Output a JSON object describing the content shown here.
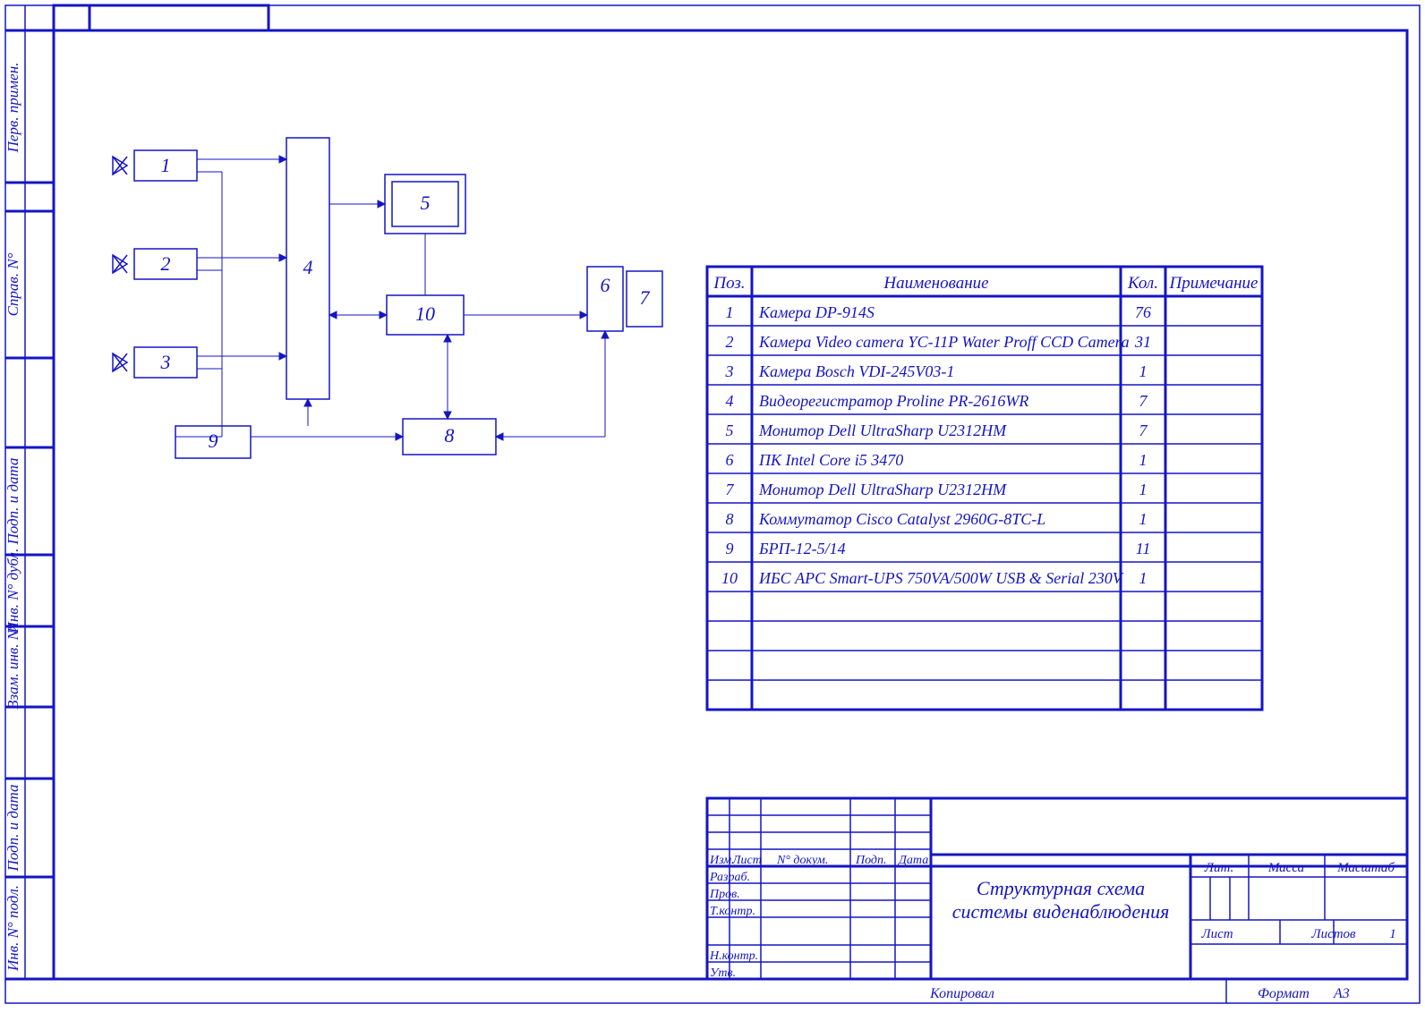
{
  "diagram": {
    "blocks": {
      "b1": "1",
      "b2": "2",
      "b3": "3",
      "b4": "4",
      "b5": "5",
      "b6": "6",
      "b7": "7",
      "b8": "8",
      "b9": "9",
      "b10": "10"
    }
  },
  "table": {
    "headers": {
      "pos": "Поз.",
      "name": "Наименование",
      "qty": "Кол.",
      "note": "Примечание"
    },
    "rows": [
      {
        "pos": "1",
        "name": "Камера DP-914S",
        "qty": "76",
        "note": ""
      },
      {
        "pos": "2",
        "name": "Камера Video camera YC-11P Water Proff CCD Camera",
        "qty": "31",
        "note": ""
      },
      {
        "pos": "3",
        "name": "Камера Bosch VDI-245V03-1",
        "qty": "1",
        "note": ""
      },
      {
        "pos": "4",
        "name": "Видеорегистратор Proline PR-2616WR",
        "qty": "7",
        "note": ""
      },
      {
        "pos": "5",
        "name": "Монитор Dell UltraSharp U2312HM",
        "qty": "7",
        "note": ""
      },
      {
        "pos": "6",
        "name": "ПК Intel Core i5 3470",
        "qty": "1",
        "note": ""
      },
      {
        "pos": "7",
        "name": "Монитор Dell UltraSharp U2312HM",
        "qty": "1",
        "note": ""
      },
      {
        "pos": "8",
        "name": "Коммутатор Cisco Catalyst 2960G-8TC-L",
        "qty": "1",
        "note": ""
      },
      {
        "pos": "9",
        "name": "БРП-12-5/14",
        "qty": "11",
        "note": ""
      },
      {
        "pos": "10",
        "name": "ИБС APC Smart-UPS 750VA/500W USB & Serial 230V",
        "qty": "1",
        "note": ""
      }
    ]
  },
  "titleblock": {
    "izm": "Изм.",
    "list": "Лист",
    "ndoc": "N° докум.",
    "podp": "Подп.",
    "data": "Дата",
    "razrab": "Разраб.",
    "prov": "Пров.",
    "tkontr": "Т.контр.",
    "nkontr": "Н.контр.",
    "utv": "Утв.",
    "title_l1": "Структурная схема",
    "title_l2": "системы виденаблюдения",
    "lit": "Лит.",
    "massa": "Масса",
    "masht": "Масштаб",
    "list2": "Лист",
    "listov": "Листов",
    "listov_n": "1",
    "kopiroval": "Копировал",
    "format": "Формат",
    "a3": "A3"
  },
  "sidebar": {
    "perv": "Перв. примен.",
    "sprav": "Справ. N°",
    "podp1": "Подп. и дата",
    "invd": "Инв. N° дубл.",
    "vzam": "Взам. инв. N°",
    "podp2": "Подп. и дата",
    "invp": "Инв. N° подл."
  }
}
